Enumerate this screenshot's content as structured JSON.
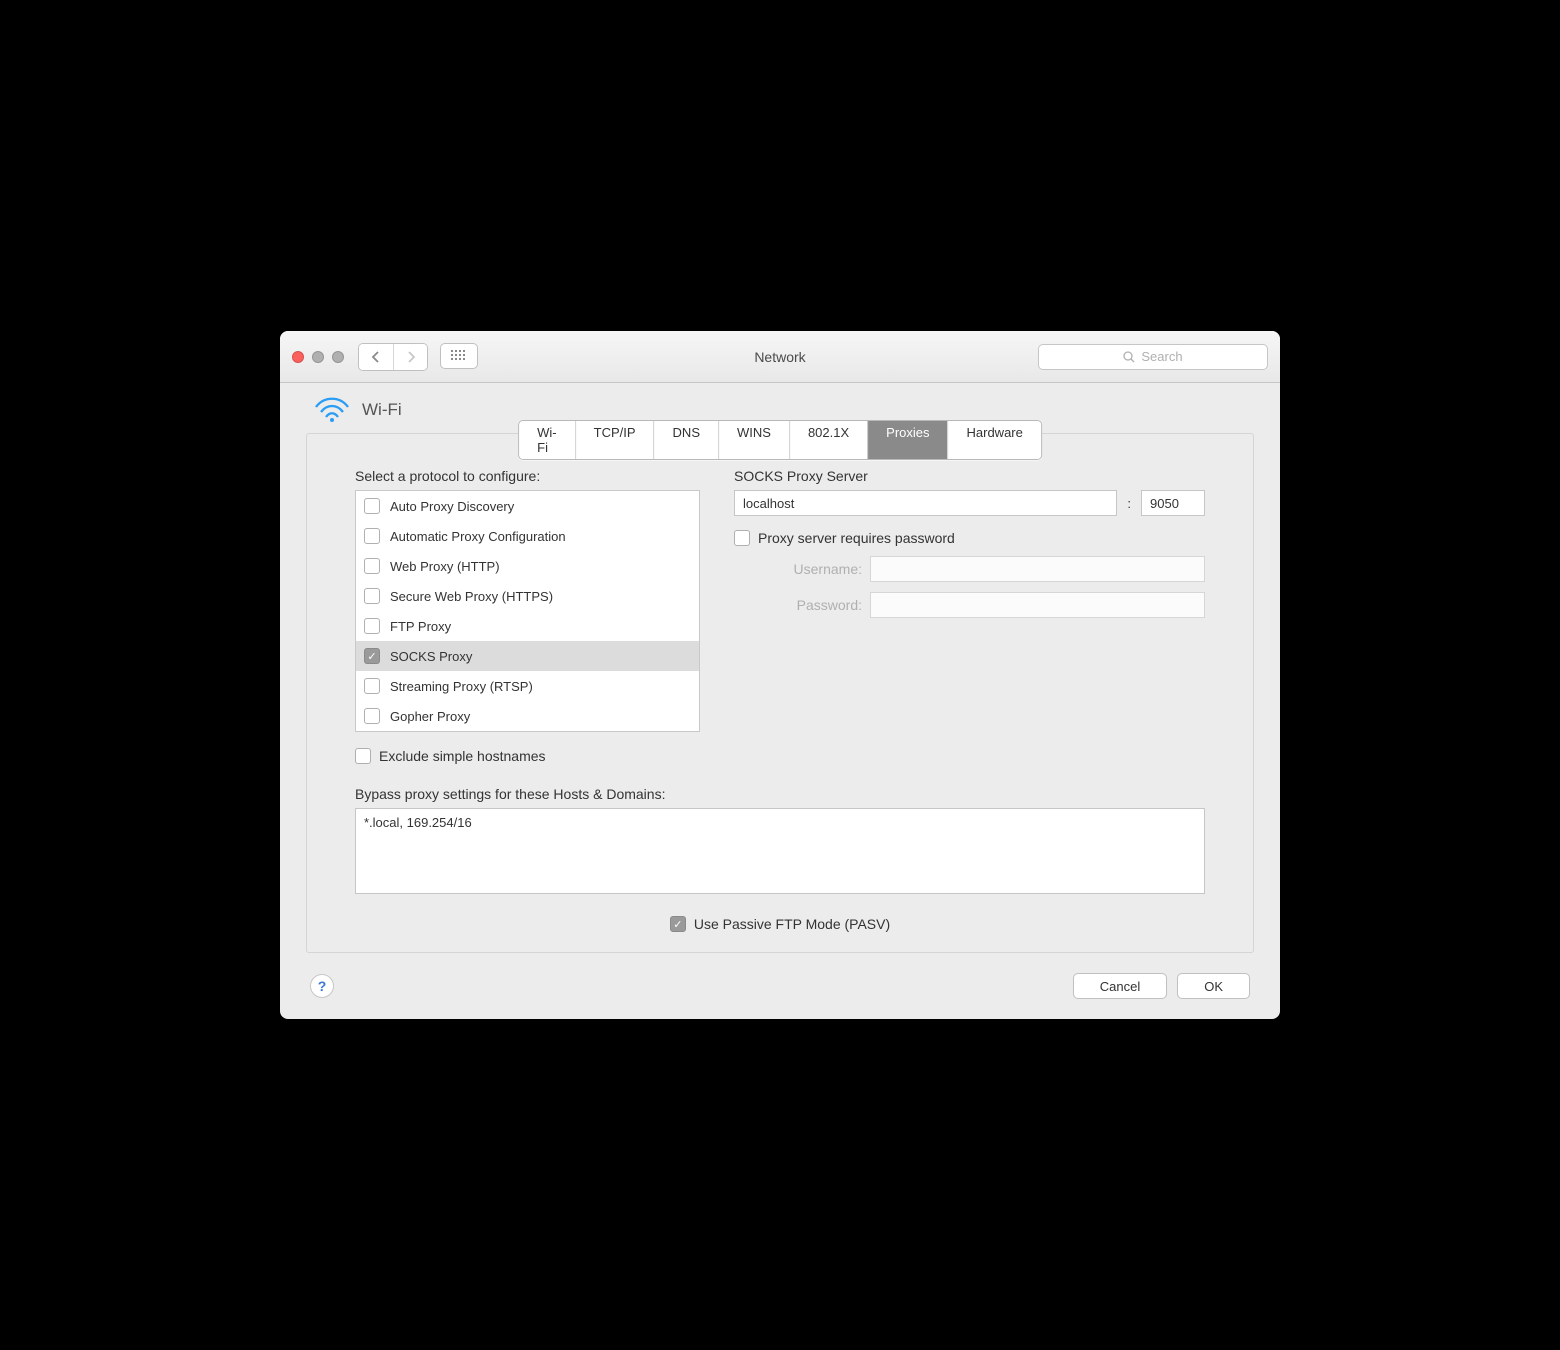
{
  "window": {
    "title": "Network"
  },
  "search": {
    "placeholder": "Search"
  },
  "header": {
    "interface_label": "Wi-Fi"
  },
  "tabs": {
    "items": [
      {
        "label": "Wi-Fi"
      },
      {
        "label": "TCP/IP"
      },
      {
        "label": "DNS"
      },
      {
        "label": "WINS"
      },
      {
        "label": "802.1X"
      },
      {
        "label": "Proxies"
      },
      {
        "label": "Hardware"
      }
    ],
    "selected": "Proxies"
  },
  "protocols": {
    "heading": "Select a protocol to configure:",
    "items": [
      {
        "label": "Auto Proxy Discovery",
        "checked": false
      },
      {
        "label": "Automatic Proxy Configuration",
        "checked": false
      },
      {
        "label": "Web Proxy (HTTP)",
        "checked": false
      },
      {
        "label": "Secure Web Proxy (HTTPS)",
        "checked": false
      },
      {
        "label": "FTP Proxy",
        "checked": false
      },
      {
        "label": "SOCKS Proxy",
        "checked": true
      },
      {
        "label": "Streaming Proxy (RTSP)",
        "checked": false
      },
      {
        "label": "Gopher Proxy",
        "checked": false
      }
    ],
    "selected_index": 5
  },
  "server": {
    "heading": "SOCKS Proxy Server",
    "host": "localhost",
    "port": "9050",
    "separator": ":",
    "requires_password_label": "Proxy server requires password",
    "requires_password_checked": false,
    "username_label": "Username:",
    "username_value": "",
    "password_label": "Password:",
    "password_value": ""
  },
  "exclude": {
    "label": "Exclude simple hostnames",
    "checked": false
  },
  "bypass": {
    "label": "Bypass proxy settings for these Hosts & Domains:",
    "value": "*.local, 169.254/16"
  },
  "pasv": {
    "label": "Use Passive FTP Mode (PASV)",
    "checked": true
  },
  "footer": {
    "cancel": "Cancel",
    "ok": "OK"
  }
}
